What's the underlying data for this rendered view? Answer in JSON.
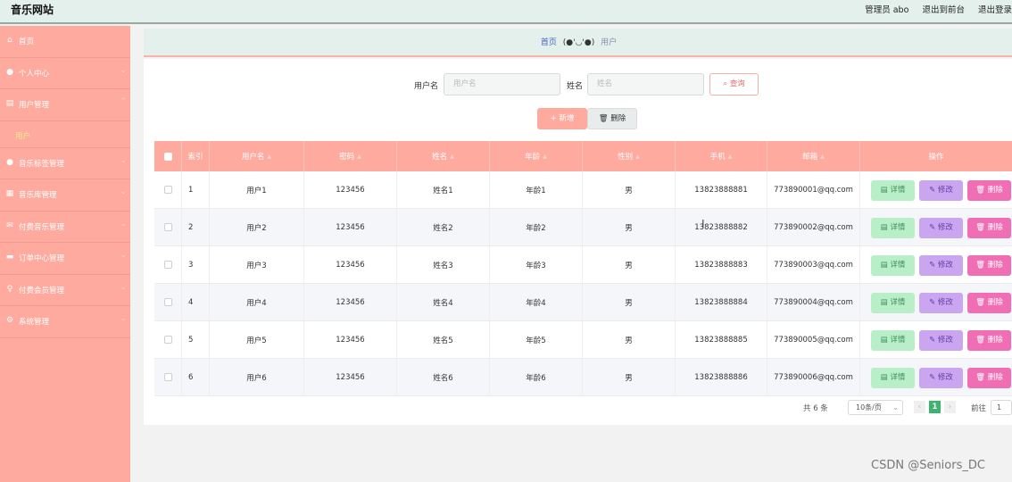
{
  "header": {
    "site_title": "音乐网站",
    "admin_label": "管理员 abo",
    "back_front": "退出到前台",
    "logout": "退出登录"
  },
  "sidebar": {
    "items": [
      {
        "label": "首页",
        "icon": "home-icon",
        "has_chevron": false
      },
      {
        "label": "个人中心",
        "icon": "user-icon",
        "has_chevron": true
      },
      {
        "label": "用户管理",
        "icon": "list-icon",
        "has_chevron": true,
        "expanded": true,
        "sub": "用户"
      },
      {
        "label": "音乐标签管理",
        "icon": "user-icon",
        "has_chevron": true
      },
      {
        "label": "音乐库管理",
        "icon": "grid-icon",
        "has_chevron": true
      },
      {
        "label": "付费音乐管理",
        "icon": "mail-icon",
        "has_chevron": true
      },
      {
        "label": "订单中心管理",
        "icon": "chat-icon",
        "has_chevron": true
      },
      {
        "label": "付费会员管理",
        "icon": "bulb-icon",
        "has_chevron": true
      },
      {
        "label": "系统管理",
        "icon": "gear-icon",
        "has_chevron": true
      }
    ]
  },
  "breadcrumb": {
    "home": "首页",
    "face": "(●'◡'●)",
    "current": "用户"
  },
  "search": {
    "username_label": "用户名",
    "username_placeholder": "用户名",
    "name_label": "姓名",
    "name_placeholder": "姓名",
    "query_label": "查询"
  },
  "actions": {
    "add_label": "新增",
    "delete_label": "删除"
  },
  "table": {
    "columns": [
      "索引",
      "用户名",
      "密码",
      "姓名",
      "年龄",
      "性别",
      "手机",
      "邮箱",
      "操作"
    ],
    "rows": [
      {
        "idx": "1",
        "username": "用户1",
        "password": "123456",
        "name": "姓名1",
        "age": "年龄1",
        "gender": "男",
        "phone": "13823888881",
        "email": "773890001@qq.com"
      },
      {
        "idx": "2",
        "username": "用户2",
        "password": "123456",
        "name": "姓名2",
        "age": "年龄2",
        "gender": "男",
        "phone": "13823888882",
        "email": "773890002@qq.com"
      },
      {
        "idx": "3",
        "username": "用户3",
        "password": "123456",
        "name": "姓名3",
        "age": "年龄3",
        "gender": "男",
        "phone": "13823888883",
        "email": "773890003@qq.com"
      },
      {
        "idx": "4",
        "username": "用户4",
        "password": "123456",
        "name": "姓名4",
        "age": "年龄4",
        "gender": "男",
        "phone": "13823888884",
        "email": "773890004@qq.com"
      },
      {
        "idx": "5",
        "username": "用户5",
        "password": "123456",
        "name": "姓名5",
        "age": "年龄5",
        "gender": "男",
        "phone": "13823888885",
        "email": "773890005@qq.com"
      },
      {
        "idx": "6",
        "username": "用户6",
        "password": "123456",
        "name": "姓名6",
        "age": "年龄6",
        "gender": "男",
        "phone": "13823888886",
        "email": "773890006@qq.com"
      }
    ],
    "row_actions": {
      "detail": "详情",
      "edit": "修改",
      "delete": "删除"
    }
  },
  "pagination": {
    "total": "共 6 条",
    "page_size": "10条/页",
    "current_page": "1",
    "goto_label": "前往",
    "goto_value": "1"
  },
  "watermark": "CSDN @Seniors_DC",
  "colors": {
    "sidebar": "#ffaa9e",
    "header": "#e3f0ec",
    "table_header": "#ffaa9e",
    "detail_button": "#b8efc9",
    "edit_button": "#c9a6ef",
    "delete_button": "#f06fb4",
    "pager_active": "#3cb371"
  }
}
